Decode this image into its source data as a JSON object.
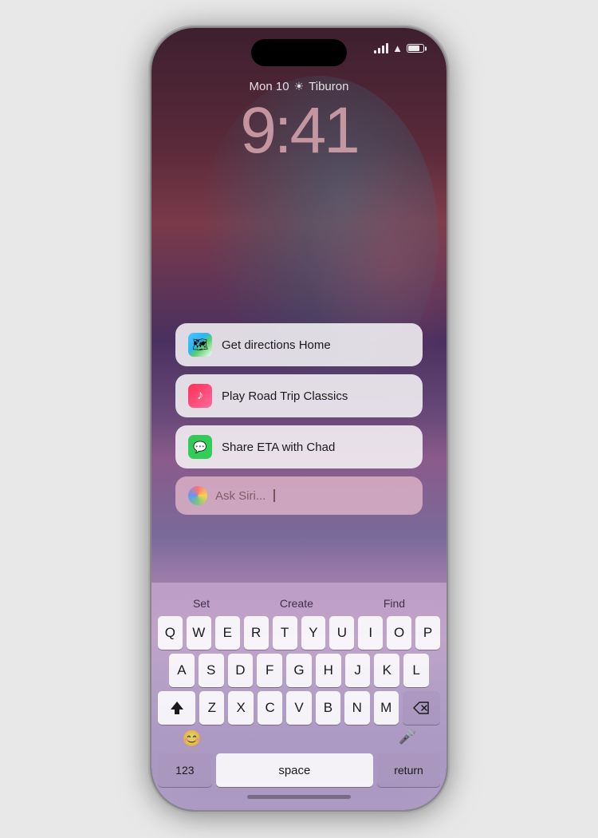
{
  "phone": {
    "status": {
      "time": "9:41",
      "date_weather": "Mon 10",
      "weather_icon": "☀",
      "location": "Tiburon"
    },
    "suggestions": [
      {
        "id": "directions",
        "icon": "🗺",
        "icon_type": "maps",
        "text": "Get directions Home"
      },
      {
        "id": "music",
        "icon": "♪",
        "icon_type": "music",
        "text": "Play Road Trip Classics"
      },
      {
        "id": "messages",
        "icon": "💬",
        "icon_type": "messages",
        "text": "Share ETA with Chad"
      }
    ],
    "siri": {
      "placeholder": "Ask Siri..."
    },
    "keyboard": {
      "suggestions": [
        "Set",
        "Create",
        "Find"
      ],
      "rows": [
        [
          "Q",
          "W",
          "E",
          "R",
          "T",
          "Y",
          "U",
          "I",
          "O",
          "P"
        ],
        [
          "A",
          "S",
          "D",
          "F",
          "G",
          "H",
          "J",
          "K",
          "L"
        ],
        [
          "⇧",
          "Z",
          "X",
          "C",
          "V",
          "B",
          "N",
          "M",
          "⌫"
        ],
        [
          "123",
          "space",
          "return"
        ]
      ]
    },
    "bottom": {
      "emoji_icon": "😊",
      "mic_icon": "🎤",
      "home_bar": true
    }
  }
}
